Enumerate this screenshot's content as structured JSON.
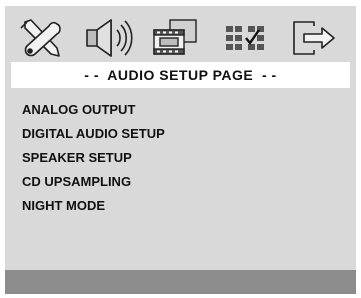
{
  "window": {
    "title": "- -  AUDIO SETUP PAGE  - -"
  },
  "icons": [
    "tools-icon",
    "speaker-icon",
    "video-film-icon",
    "preferences-grid-icon",
    "exit-icon"
  ],
  "menu": {
    "items": [
      {
        "label": "ANALOG OUTPUT"
      },
      {
        "label": "DIGITAL AUDIO SETUP"
      },
      {
        "label": "SPEAKER SETUP"
      },
      {
        "label": "CD UPSAMPLING"
      },
      {
        "label": "NIGHT MODE"
      }
    ]
  },
  "colors": {
    "panel": "#d9d9d9",
    "title_bar": "#ffffff",
    "footer": "#8c8c8c",
    "text": "#111111"
  }
}
